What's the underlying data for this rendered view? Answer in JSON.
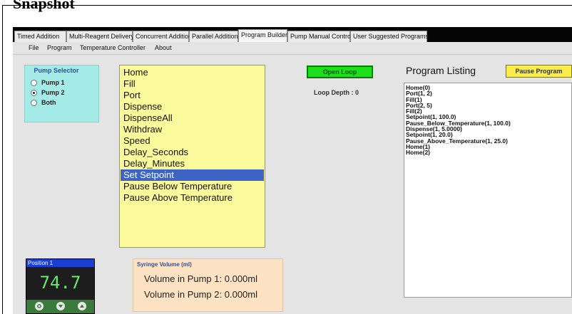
{
  "document": {
    "heading": "Snapshot"
  },
  "tabs": [
    {
      "label": "Timed Addition",
      "active": false
    },
    {
      "label": "Multi-Reagent Delivery",
      "active": false
    },
    {
      "label": "Concurrent Addition",
      "active": false
    },
    {
      "label": "Parallel Addition",
      "active": false
    },
    {
      "label": "Program Builder",
      "active": true
    },
    {
      "label": "Pump Manual Control",
      "active": false
    },
    {
      "label": "User Suggested Programs",
      "active": false
    }
  ],
  "menu": [
    "File",
    "Program",
    "Temperature Controller",
    "About"
  ],
  "pump_selector": {
    "title": "Pump Selector",
    "options": [
      "Pump 1",
      "Pump 2",
      "Both"
    ],
    "selected": "Pump 2"
  },
  "commands": {
    "items": [
      "Home",
      "Fill",
      "Port",
      "Dispense",
      "DispenseAll",
      "Withdraw",
      "Speed",
      "Delay_Seconds",
      "Delay_Minutes",
      "Set Setpoint",
      "Pause Below Temperature",
      "Pause Above Temperature"
    ],
    "selected": "Set Setpoint"
  },
  "loop": {
    "open_loop_label": "Open Loop",
    "depth_label": "Loop Depth : 0"
  },
  "program_listing": {
    "title": "Program Listing",
    "pause_label": "Pause Program",
    "lines": [
      "Home(0)",
      "Port(1, 2)",
      "Fill(1)",
      "Port(2, 5)",
      "Fill(2)",
      "Setpoint(1, 100.0)",
      "Pause_Below_Temperature(1, 100.0)",
      "Dispense(1, 5.0000)",
      "Setpoint(1, 20.0)",
      "Pause_Above_Temperature(1, 25.0)",
      "Home(1)",
      "Home(2)"
    ]
  },
  "temperature": {
    "header": "Position 1",
    "value": "74.7"
  },
  "syringe": {
    "title": "Syringe Volume (ml)",
    "pump1_label": "Volume in Pump 1:",
    "pump1_value": "0.000ml",
    "pump2_label": "Volume in Pump 2:",
    "pump2_value": "0.000ml"
  },
  "colors": {
    "tabbar": "#050505",
    "command_list_bg": "#fbfb9d",
    "selection": "#3d64c4",
    "pump_selector_bg": "#a4ebe8",
    "open_loop_bg": "#1ce01c",
    "pause_bg": "#fbee4a",
    "syringe_bg": "#fde3c4",
    "temp_value": "#6ee66e"
  }
}
